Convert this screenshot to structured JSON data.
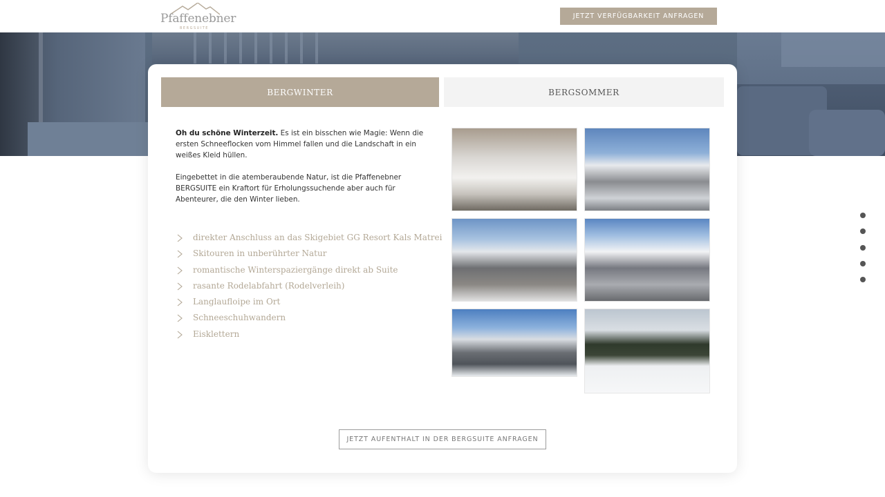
{
  "header": {
    "logo_name": "Pfaffenebner",
    "logo_sub": "BERGSUITE",
    "cta_label": "Jetzt Verfügbarkeit anfragen"
  },
  "tabs": [
    {
      "label": "Bergwinter",
      "active": true
    },
    {
      "label": "Bergsommer",
      "active": false
    }
  ],
  "intro": {
    "lead_bold": "Oh du schöne Winterzeit.",
    "lead_rest": " Es ist ein bisschen wie Magie: Wenn die ersten Schneeflocken vom Himmel fallen und die Landschaft in ein weißes Kleid hüllen.",
    "paragraph2": "Eingebettet in die atemberaubende Natur, ist die Pfaffenebner BERGSUITE ein Kraftort für Erholungssuchende aber auch für Abenteurer, die den Winter lieben."
  },
  "features": [
    "direkter Anschluss an das Skigebiet GG Resort Kals Matrei",
    "Skitouren in unberührter Natur",
    "romantische Winterspaziergänge direkt ab Suite",
    "rasante Rodelabfahrt (Rodelverleih)",
    "Langlaufloipe im Ort",
    "Schneeschuhwandern",
    "Eisklettern"
  ],
  "gallery_count": 6,
  "dots_count": 5,
  "bottom_cta_label": "Jetzt Aufenthalt in der Bergsuite anfragen",
  "colors": {
    "accent": "#b5a998",
    "feature_text": "#b3a896",
    "tab_inactive_bg": "#f3f3f3",
    "dot": "#555555"
  },
  "icons": {
    "feature_bullet": "chevron-right-icon",
    "logo_mark": "mountain-icon"
  }
}
